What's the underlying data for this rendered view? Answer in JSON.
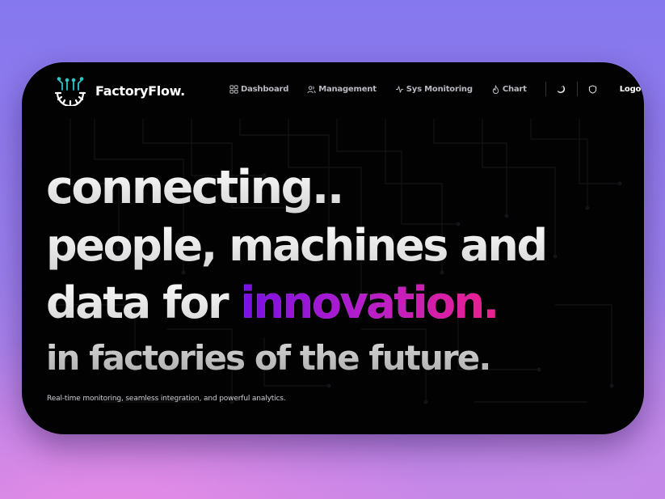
{
  "brand": {
    "name": "FactoryFlow.",
    "logo_icon": "gear-circuit-logo-icon"
  },
  "nav": {
    "links": [
      {
        "label": "Dashboard",
        "icon": "grid-icon"
      },
      {
        "label": "Management",
        "icon": "users-icon"
      },
      {
        "label": "Sys Monitoring",
        "icon": "pulse-icon"
      },
      {
        "label": "Chart",
        "icon": "flame-icon"
      }
    ],
    "theme_toggle_icon": "moon-icon",
    "security_icon": "shield-icon",
    "logout_label": "Logout"
  },
  "hero": {
    "line1": "connecting..",
    "line2": "people, machines and",
    "line3_prefix": "data for ",
    "line3_accent": "innovation.",
    "subline": "in factories of the future.",
    "tagline": "Real-time monitoring, seamless integration, and powerful analytics."
  },
  "colors": {
    "card_background": "#020203",
    "accent_start": "#7a0fe6",
    "accent_mid": "#b81ec9",
    "accent_end": "#ef1f8c",
    "nav_text": "#b9b9c2",
    "logo_accent": "#29c7c7"
  }
}
